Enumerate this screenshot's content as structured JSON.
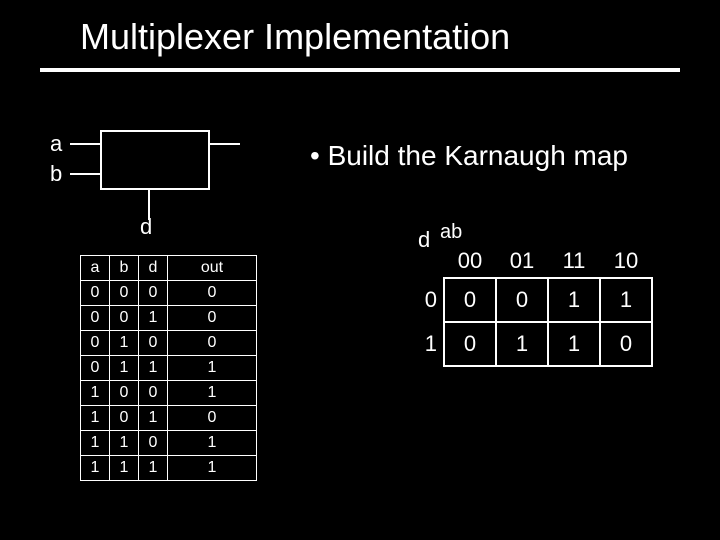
{
  "title": "Multiplexer Implementation",
  "bullet": "• Build the Karnaugh map",
  "inputs": {
    "a": "a",
    "b": "b",
    "d": "d"
  },
  "truth_table": {
    "headers": [
      "a",
      "b",
      "d",
      "out"
    ],
    "rows": [
      [
        "0",
        "0",
        "0",
        "0"
      ],
      [
        "0",
        "0",
        "1",
        "0"
      ],
      [
        "0",
        "1",
        "0",
        "0"
      ],
      [
        "0",
        "1",
        "1",
        "1"
      ],
      [
        "1",
        "0",
        "0",
        "1"
      ],
      [
        "1",
        "0",
        "1",
        "0"
      ],
      [
        "1",
        "1",
        "0",
        "1"
      ],
      [
        "1",
        "1",
        "1",
        "1"
      ]
    ]
  },
  "kmap": {
    "col_var": "ab",
    "row_var": "d",
    "col_headers": [
      "00",
      "01",
      "11",
      "10"
    ],
    "row_headers": [
      "0",
      "1"
    ],
    "cells": [
      [
        "0",
        "0",
        "1",
        "1"
      ],
      [
        "0",
        "1",
        "1",
        "0"
      ]
    ]
  }
}
